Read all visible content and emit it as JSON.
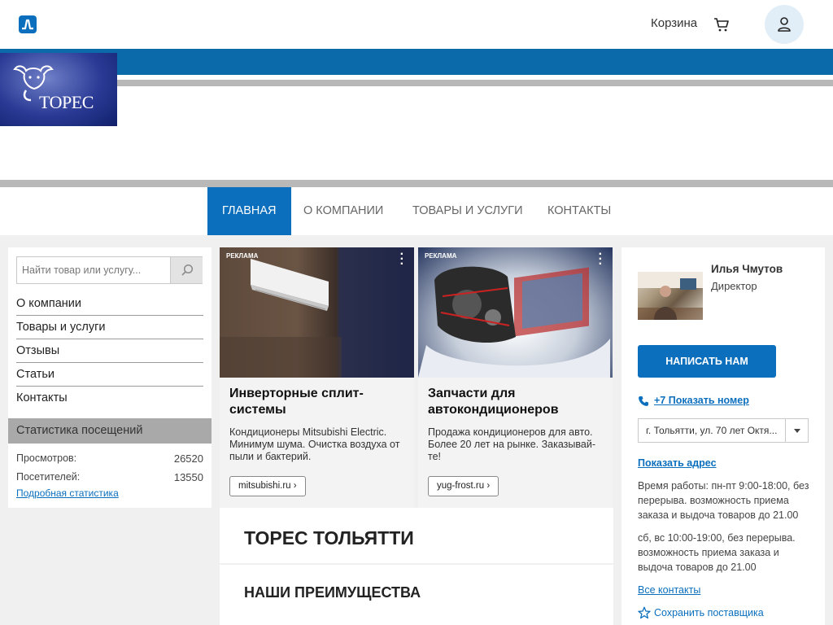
{
  "topbar": {
    "brand_icon": "brand-logo-icon",
    "cart_label": "Корзина",
    "cart_icon": "cart-icon",
    "user_icon": "user-icon"
  },
  "header": {
    "logo_text": "ТОРЕС"
  },
  "nav": {
    "items": [
      {
        "label": "ГЛАВНАЯ",
        "active": true
      },
      {
        "label": "О КОМПАНИИ",
        "active": false
      },
      {
        "label": "ТОВАРЫ И УСЛУГИ",
        "active": false
      },
      {
        "label": "КОНТАКТЫ",
        "active": false
      }
    ]
  },
  "sidebar": {
    "search_placeholder": "Найти товар или услугу...",
    "links": [
      "О компании",
      "Товары и услуги",
      "Отзывы",
      "Статьи",
      "Контакты"
    ],
    "stats_title": "Статистика посещений",
    "stats": [
      {
        "label": "Просмотров:",
        "value": "26520"
      },
      {
        "label": "Посетителей:",
        "value": "13550"
      }
    ],
    "stats_link": "Подробная статистика"
  },
  "ads": [
    {
      "tag": "РЕКЛАМА",
      "title": "Инверторные сплит-системы",
      "text": "Кондиционеры Mitsubishi Electric. Минимум шума. Очистка воздуха от пыли и бактерий.",
      "button": "mitsubishi.ru ›"
    },
    {
      "tag": "РЕКЛАМА",
      "title": "Запчасти для автокондиционеров",
      "text": "Продажа кондиционеров для авто. Более 20 лет на рынке. Заказывай-те!",
      "button": "yug-frost.ru ›"
    }
  ],
  "main": {
    "company_title": "ТОРЕС ТОЛЬЯТТИ",
    "advantages_title": "НАШИ ПРЕИМУЩЕСТВА"
  },
  "contact": {
    "name": "Илья Чмутов",
    "role": "Директор",
    "write_button": "НАПИСАТЬ НАМ",
    "phone_link": "+7 Показать номер",
    "address": "г. Тольятти, ул. 70 лет Октя...",
    "show_address": "Показать адрес",
    "hours_weekdays": "Время работы: пн-пт 9:00-18:00, без перерыва. возможность приема заказа и выдоча товаров до 21.00",
    "hours_weekend": "сб, вс 10:00-19:00, без перерыва. возможность приема заказа и выдоча товаров до 21.00",
    "all_contacts": "Все контакты",
    "save_supplier": "Сохранить поставщика"
  },
  "colors": {
    "accent": "#0b6fbd",
    "banner_blue": "#0b6aaa",
    "banner_gray": "#b8b8b8",
    "stats_header_bg": "#a9a9a9"
  }
}
